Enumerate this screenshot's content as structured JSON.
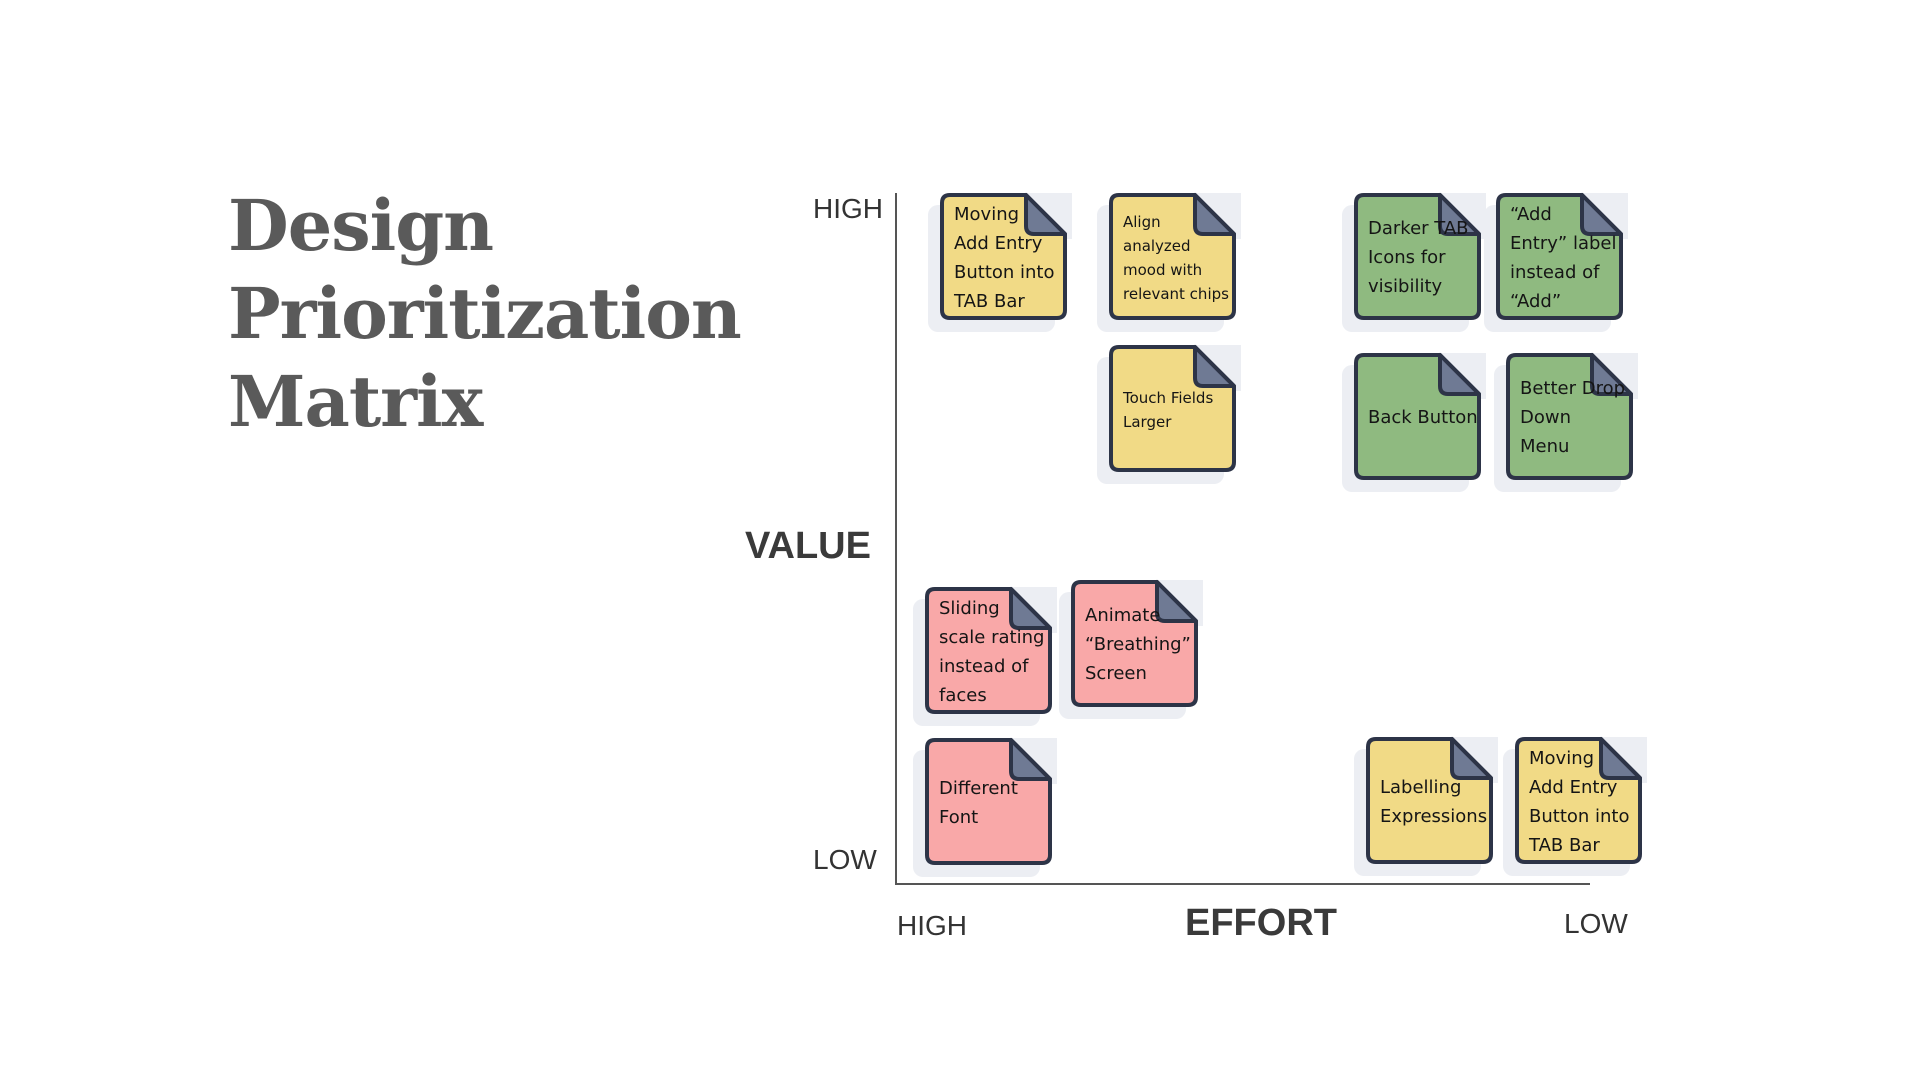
{
  "title": {
    "lines": [
      "Design",
      "Prioritization",
      "Matrix"
    ]
  },
  "colors": {
    "border": "#2d3447",
    "fold": "#6f7a94",
    "shadow": "#eceef3",
    "yellow": "#f1da86",
    "green": "#8fba80",
    "pink": "#f9a8a8",
    "title": "#5a5a5a"
  },
  "axes": {
    "y_title": "VALUE",
    "y_high": "HIGH",
    "y_low": "LOW",
    "x_title": "EFFORT",
    "x_high": "HIGH",
    "x_low": "LOW"
  },
  "notes": [
    {
      "id": "n1",
      "color": "yellow",
      "lines": [
        "Moving",
        "Add Entry",
        "Button into",
        "TAB Bar"
      ],
      "value": "high",
      "effort": "high"
    },
    {
      "id": "n2",
      "color": "yellow",
      "lines": [
        "Align",
        "analyzed",
        "mood with",
        "relevant chips"
      ],
      "value": "high",
      "effort": "high"
    },
    {
      "id": "n3",
      "color": "yellow",
      "lines": [
        "Touch Fields",
        "Larger"
      ],
      "value": "high",
      "effort": "high"
    },
    {
      "id": "n4",
      "color": "green",
      "lines": [
        "Darker TAB",
        "Icons for",
        "visibility"
      ],
      "value": "high",
      "effort": "low"
    },
    {
      "id": "n5",
      "color": "green",
      "lines": [
        "“Add",
        "Entry” label",
        "instead of",
        "“Add”"
      ],
      "value": "high",
      "effort": "low"
    },
    {
      "id": "n6",
      "color": "green",
      "lines": [
        "Back Button"
      ],
      "value": "high",
      "effort": "low"
    },
    {
      "id": "n7",
      "color": "green",
      "lines": [
        "Better Drop",
        "Down",
        "Menu"
      ],
      "value": "high",
      "effort": "low"
    },
    {
      "id": "n8",
      "color": "pink",
      "lines": [
        "Sliding",
        "scale rating",
        "instead of",
        "faces"
      ],
      "value": "low",
      "effort": "high"
    },
    {
      "id": "n9",
      "color": "pink",
      "lines": [
        "Animate",
        "“Breathing”",
        "Screen"
      ],
      "value": "low",
      "effort": "high"
    },
    {
      "id": "n10",
      "color": "pink",
      "lines": [
        "Different",
        "Font"
      ],
      "value": "low",
      "effort": "high"
    },
    {
      "id": "n11",
      "color": "yellow",
      "lines": [
        "Labelling",
        "Expressions"
      ],
      "value": "low",
      "effort": "low"
    },
    {
      "id": "n12",
      "color": "yellow",
      "lines": [
        "Moving",
        "Add Entry",
        "Button into",
        "TAB Bar"
      ],
      "value": "low",
      "effort": "low"
    }
  ]
}
